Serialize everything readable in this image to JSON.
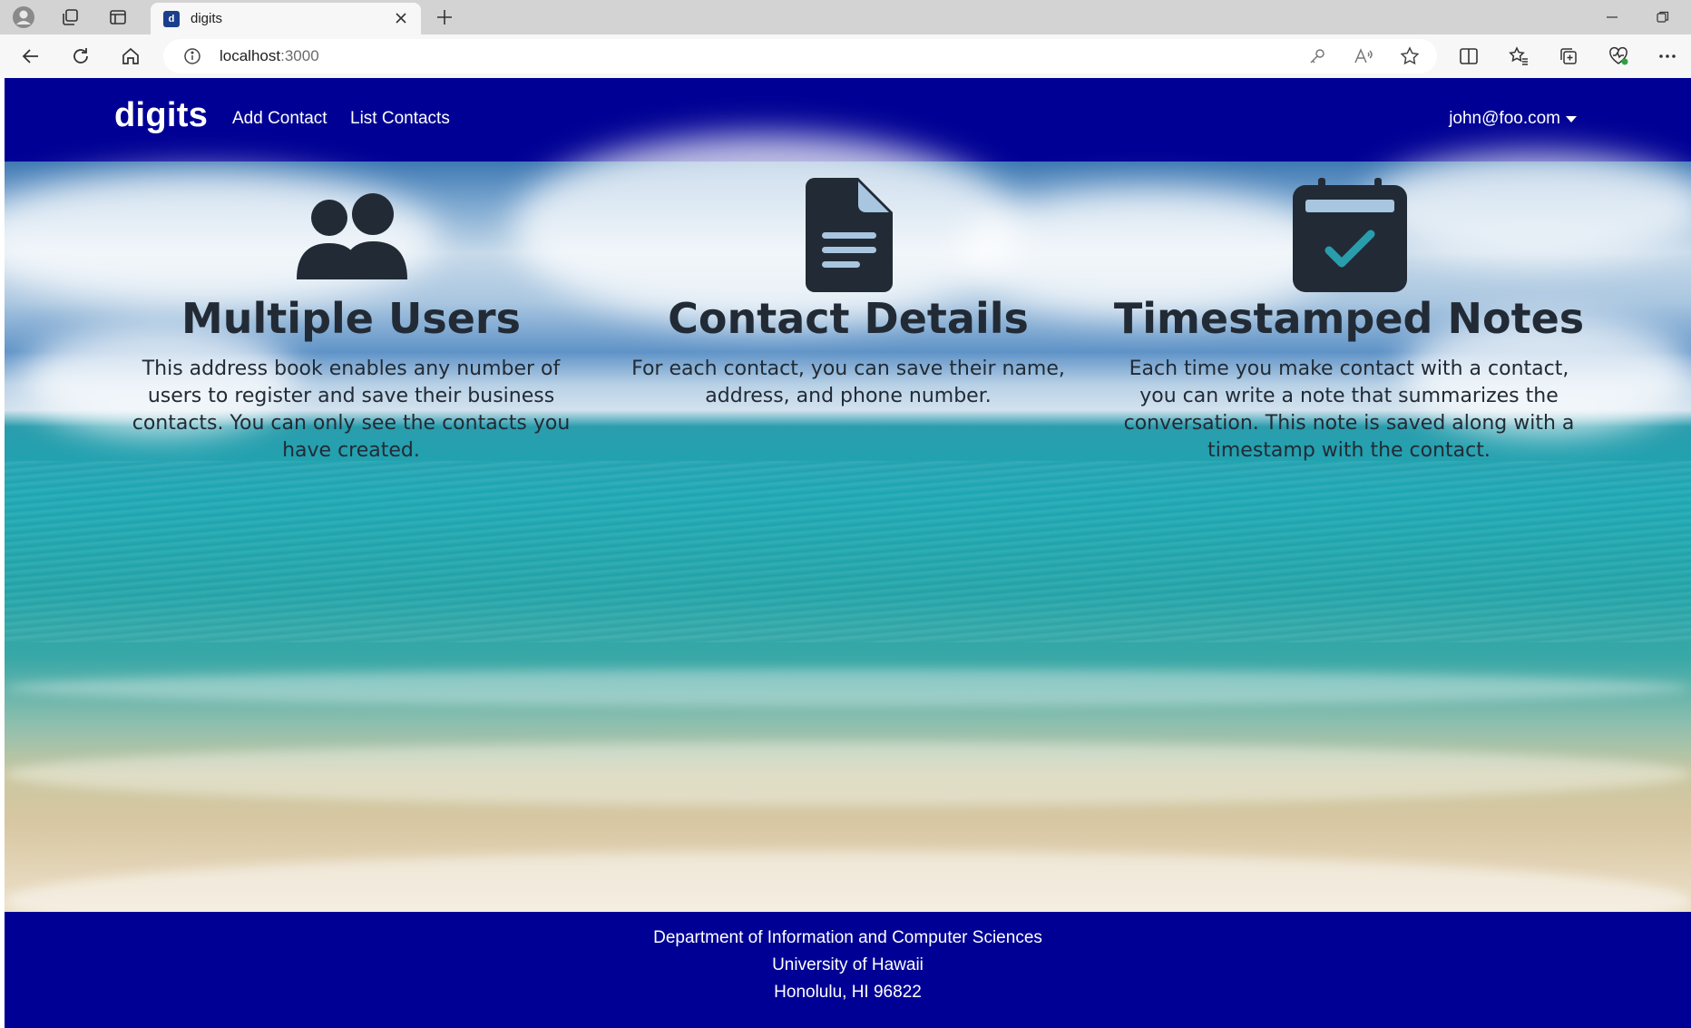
{
  "browser": {
    "tab_title": "digits",
    "tab_favicon_letter": "d",
    "url_host": "localhost",
    "url_port": ":3000"
  },
  "navbar": {
    "brand": "digits",
    "links": [
      "Add Contact",
      "List Contacts"
    ],
    "user": "john@foo.com",
    "background_color": "#000095"
  },
  "features": [
    {
      "icon": "users-icon",
      "title": "Multiple Users",
      "text": "This address book enables any number of users to register and save their business contacts. You can only see the contacts you have created."
    },
    {
      "icon": "file-text-icon",
      "title": "Contact Details",
      "text": "For each contact, you can save their name, address, and phone number."
    },
    {
      "icon": "calendar-check-icon",
      "title": "Timestamped Notes",
      "text": "Each time you make contact with a contact, you can write a note that summarizes the conversation. This note is saved along with a timestamp with the contact."
    }
  ],
  "footer": {
    "lines": [
      "Department of Information and Computer Sciences",
      "University of Hawaii",
      "Honolulu, HI 96822"
    ]
  }
}
